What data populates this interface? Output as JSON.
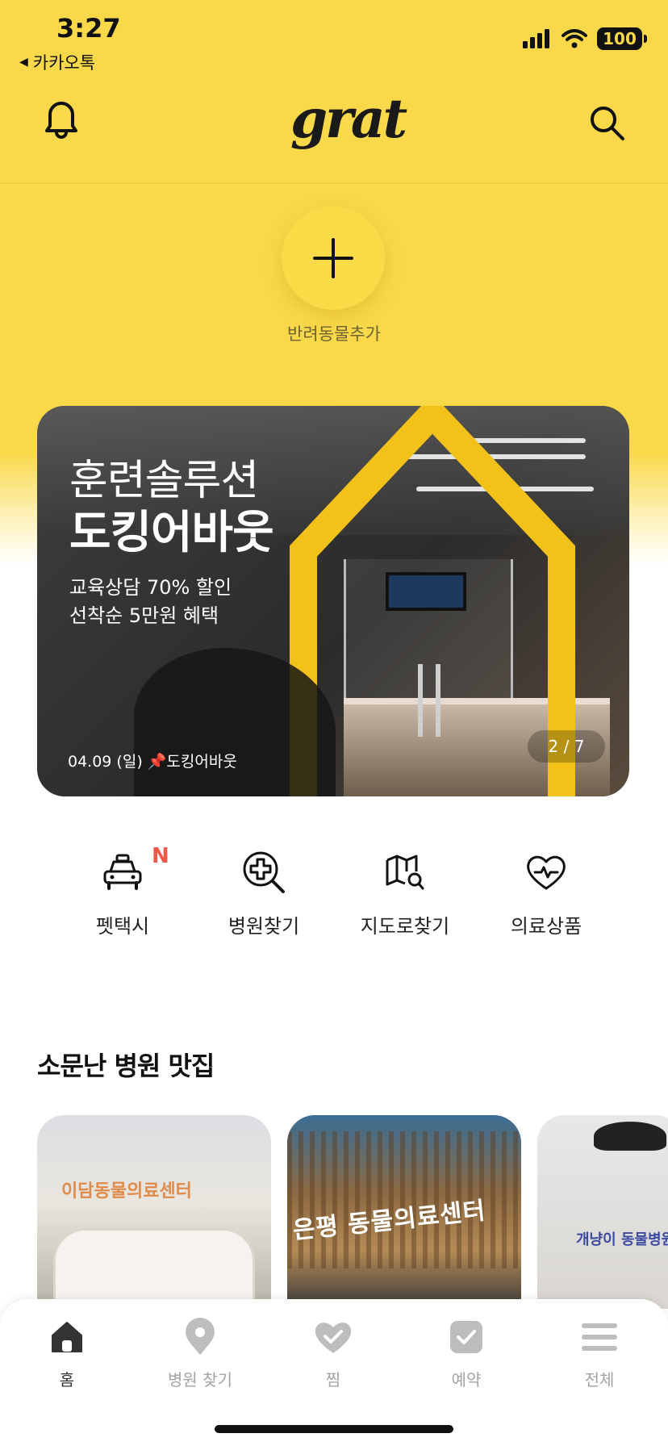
{
  "status_bar": {
    "time": "3:27",
    "back_app": "카카오톡",
    "battery": "100"
  },
  "header": {
    "logo": "grat",
    "bell_icon": "bell-icon",
    "search_icon": "search-icon"
  },
  "add_pet": {
    "label": "반려동물추가",
    "icon": "plus-icon"
  },
  "banner": {
    "title_line1": "훈련솔루션",
    "title_line2": "도킹어바웃",
    "sub_line1": "교육상담 70% 할인",
    "sub_line2": "선착순 5만원 혜택",
    "caption": "04.09 (일) 📌도킹어바웃",
    "page_indicator": "2 / 7"
  },
  "quick_menu": [
    {
      "label": "펫택시",
      "icon": "taxi-icon",
      "badge": "N"
    },
    {
      "label": "병원찾기",
      "icon": "hospital-search-icon"
    },
    {
      "label": "지도로찾기",
      "icon": "map-search-icon"
    },
    {
      "label": "의료상품",
      "icon": "heart-pulse-icon"
    }
  ],
  "section": {
    "title": "소문난 병원 맛집"
  },
  "hospitals": [
    {
      "sign": "이담동물의료센터"
    },
    {
      "sign": "은평 동물의료센터"
    },
    {
      "sign": "개냥이 동물병원"
    }
  ],
  "tabs": [
    {
      "label": "홈",
      "icon": "home-icon",
      "active": true
    },
    {
      "label": "병원 찾기",
      "icon": "location-pin-icon"
    },
    {
      "label": "찜",
      "icon": "heart-icon"
    },
    {
      "label": "예약",
      "icon": "check-icon"
    },
    {
      "label": "전체",
      "icon": "menu-icon"
    }
  ],
  "colors": {
    "brand_yellow": "#F9D84A",
    "badge_red": "#F0584A"
  }
}
